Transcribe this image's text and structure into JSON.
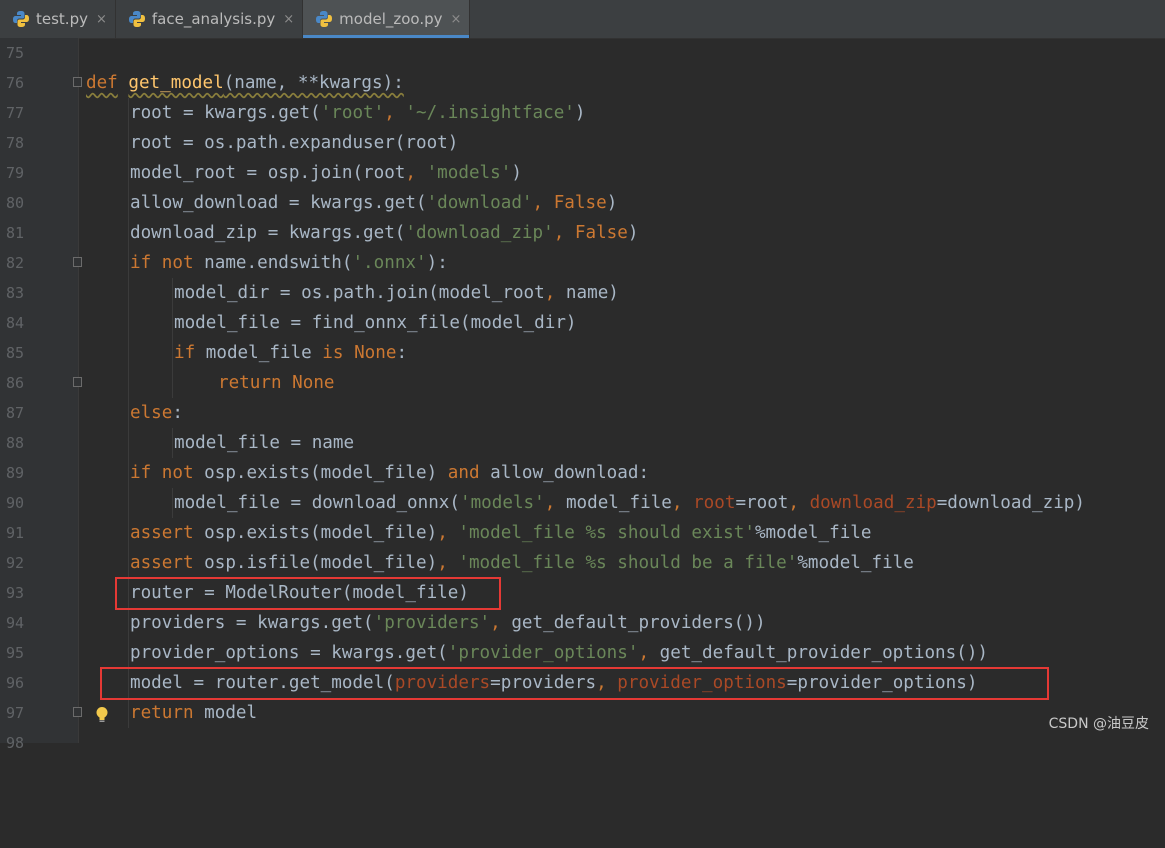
{
  "tabs": [
    {
      "label": "test.py",
      "active": false
    },
    {
      "label": "face_analysis.py",
      "active": false
    },
    {
      "label": "model_zoo.py",
      "active": true
    }
  ],
  "tab_close_glyph": "×",
  "line_numbers": [
    "75",
    "76",
    "77",
    "78",
    "79",
    "80",
    "81",
    "82",
    "83",
    "84",
    "85",
    "86",
    "87",
    "88",
    "89",
    "90",
    "91",
    "92",
    "93",
    "94",
    "95",
    "96",
    "97",
    "98"
  ],
  "code": {
    "l76": {
      "def": "def",
      "name": "get_model",
      "rest": "(name, **kwargs):"
    },
    "l77": {
      "a": "root = kwargs.get(",
      "s1": "'root'",
      "c": ", ",
      "s2": "'~/.insightface'",
      "e": ")"
    },
    "l78": {
      "a": "root = os.path.expanduser(root)"
    },
    "l79": {
      "a": "model_root = osp.join(root",
      "c": ", ",
      "s1": "'models'",
      "e": ")"
    },
    "l80": {
      "a": "allow_download = kwargs.get(",
      "s1": "'download'",
      "c": ", ",
      "k": "False",
      "e": ")"
    },
    "l81": {
      "a": "download_zip = kwargs.get(",
      "s1": "'download_zip'",
      "c": ", ",
      "k": "False",
      "e": ")"
    },
    "l82": {
      "if": "if",
      "not": "not",
      "a": " name.endswith(",
      "s1": "'.onnx'",
      "e": "):"
    },
    "l83": {
      "a": "model_dir = os.path.join(model_root",
      "c": ", ",
      "b": "name)"
    },
    "l84": {
      "a": "model_file = find_onnx_file(model_dir)"
    },
    "l85": {
      "if": "if",
      "a": " model_file ",
      "is": "is",
      "none": "None",
      "e": ":"
    },
    "l86": {
      "ret": "return",
      "none": "None"
    },
    "l87": {
      "else": "else",
      "e": ":"
    },
    "l88": {
      "a": "model_file = name"
    },
    "l89": {
      "if": "if",
      "not": "not",
      "a": " osp.exists(model_file) ",
      "and": "and",
      "b": " allow_download:"
    },
    "l90": {
      "a": "model_file = download_onnx(",
      "s1": "'models'",
      "c": ", ",
      "b": "model_file",
      "p1": "root",
      "eq1": "=root",
      "p2": "download_zip",
      "eq2": "=download_zip)"
    },
    "l91": {
      "kw": "assert",
      "a": " osp.exists(model_file)",
      "c": ", ",
      "s1": "'model_file %s should exist'",
      "e": "%model_file"
    },
    "l92": {
      "kw": "assert",
      "a": " osp.isfile(model_file)",
      "c": ", ",
      "s1": "'model_file %s should be a file'",
      "e": "%model_file"
    },
    "l93": {
      "a": "router = ModelRouter(model_file)"
    },
    "l94": {
      "a": "providers = kwargs.get(",
      "s1": "'providers'",
      "c": ", ",
      "b": "get_default_providers())"
    },
    "l95": {
      "a": "provider_options = kwargs.get(",
      "s1": "'provider_options'",
      "c": ", ",
      "b": "get_default_provider_options())"
    },
    "l96": {
      "a": "model = router.get_model(",
      "p1": "providers",
      "eq1": "=providers",
      "c": ", ",
      "p2": "provider_options",
      "eq2": "=provider_options)"
    },
    "l97": {
      "ret": "return",
      "a": " model"
    }
  },
  "watermark": "CSDN @油豆皮",
  "colors": {
    "keyword": "#cc7832",
    "function": "#ffc66d",
    "string": "#6a8759",
    "param": "#aa4926",
    "highlight_box": "#e53935"
  }
}
